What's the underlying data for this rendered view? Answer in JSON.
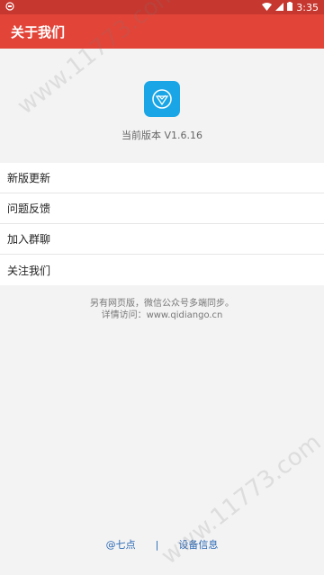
{
  "status_bar": {
    "time": "3:35"
  },
  "toolbar": {
    "title": "关于我们"
  },
  "about": {
    "version_text": "当前版本 V1.6.16"
  },
  "menu": {
    "items": [
      {
        "label": "新版更新"
      },
      {
        "label": "问题反馈"
      },
      {
        "label": "加入群聊"
      },
      {
        "label": "关注我们"
      }
    ]
  },
  "footer": {
    "line1": "另有网页版，微信公众号多端同步。",
    "line2": "详情访问：www.qidiango.cn"
  },
  "bottom_links": {
    "left": "@七点",
    "separator": "|",
    "right": "设备信息"
  },
  "watermark": {
    "text": "www.11773.com"
  },
  "colors": {
    "toolbar_bg": "#e34438",
    "statusbar_bg": "#c6372f",
    "accent_link": "#2a69b6",
    "app_icon_bg": "#1aa6e6"
  }
}
